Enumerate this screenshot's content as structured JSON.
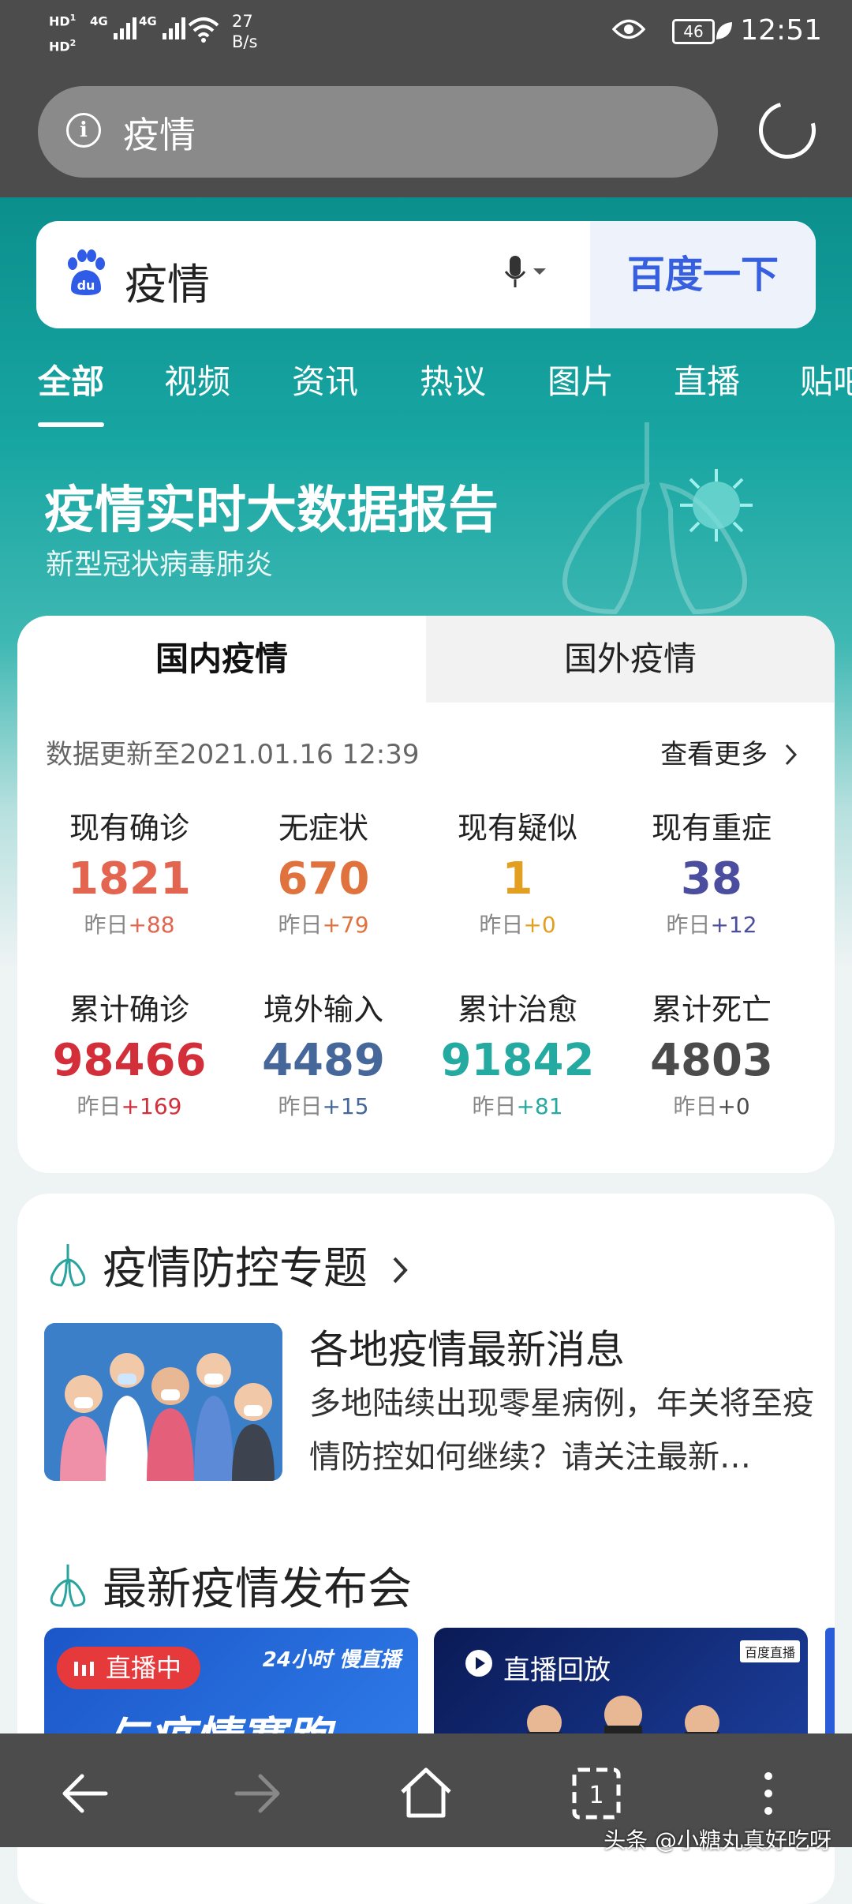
{
  "status_bar": {
    "hd1": "HD",
    "hd1_sub": "1",
    "hd2": "HD",
    "hd2_sub": "2",
    "net1": "4G",
    "net2": "4G",
    "speed_value": "27",
    "speed_unit": "B/s",
    "battery": "46",
    "time": "12:51"
  },
  "url_bar": {
    "text": "疫情"
  },
  "search": {
    "query": "疫情",
    "button": "百度一下"
  },
  "tabs": [
    "全部",
    "视频",
    "资讯",
    "热议",
    "图片",
    "直播",
    "贴吧"
  ],
  "hero": {
    "title": "疫情实时大数据报告",
    "subtitle": "新型冠状病毒肺炎"
  },
  "data_card": {
    "tab_domestic": "国内疫情",
    "tab_foreign": "国外疫情",
    "updated": "数据更新至2021.01.16 12:39",
    "more": "查看更多",
    "stats": [
      {
        "label": "现有确诊",
        "value": "1821",
        "delta_prefix": "昨日",
        "delta": "+88",
        "color": "#e3644f",
        "delta_color": "#e3644f"
      },
      {
        "label": "无症状",
        "value": "670",
        "delta_prefix": "昨日",
        "delta": "+79",
        "color": "#e0723e",
        "delta_color": "#e0723e"
      },
      {
        "label": "现有疑似",
        "value": "1",
        "delta_prefix": "昨日",
        "delta": "+0",
        "color": "#e3a020",
        "delta_color": "#e3a020"
      },
      {
        "label": "现有重症",
        "value": "38",
        "delta_prefix": "昨日",
        "delta": "+12",
        "color": "#4b4d9e",
        "delta_color": "#4b4d9e"
      },
      {
        "label": "累计确诊",
        "value": "98466",
        "delta_prefix": "昨日",
        "delta": "+169",
        "color": "#d32f3b",
        "delta_color": "#d32f3b"
      },
      {
        "label": "境外输入",
        "value": "4489",
        "delta_prefix": "昨日",
        "delta": "+15",
        "color": "#46679a",
        "delta_color": "#46679a"
      },
      {
        "label": "累计治愈",
        "value": "91842",
        "delta_prefix": "昨日",
        "delta": "+81",
        "color": "#25aaa2",
        "delta_color": "#25aaa2"
      },
      {
        "label": "累计死亡",
        "value": "4803",
        "delta_prefix": "昨日",
        "delta": "+0",
        "color": "#4b4b4b",
        "delta_color": "#4b4b4b"
      }
    ]
  },
  "topic": {
    "section_title": "疫情防控专题",
    "news_title": "各地疫情最新消息",
    "news_desc": "多地陆续出现零星病例，年关将至疫情防控如何继续？请关注最新…",
    "press_title": "最新疫情发布会",
    "live_badge": "直播中",
    "live_brand": "24小时 慢直播",
    "live_headline": "与疫情赛跑",
    "replay_label": "直播回放",
    "replay_brand": "百度直播"
  },
  "watermark": "头条 @小糖丸真好吃呀",
  "colors": {
    "teal": "#0b8f8d",
    "baidu_blue": "#3660e0",
    "live_red": "#e6393c"
  }
}
